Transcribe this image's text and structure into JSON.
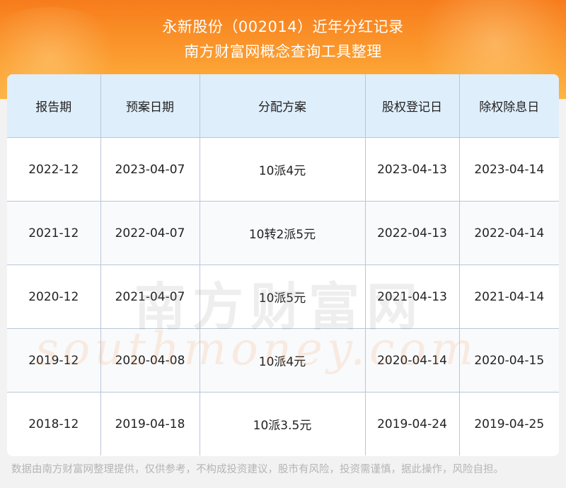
{
  "header": {
    "title": "永新股份（002014）近年分红记录",
    "subtitle": "南方财富网概念查询工具整理"
  },
  "table": {
    "columns": [
      "报告期",
      "预案日期",
      "分配方案",
      "股权登记日",
      "除权除息日"
    ],
    "rows": [
      [
        "2022-12",
        "2023-04-07",
        "10派4元",
        "2023-04-13",
        "2023-04-14"
      ],
      [
        "2021-12",
        "2022-04-07",
        "10转2派5元",
        "2022-04-13",
        "2022-04-14"
      ],
      [
        "2020-12",
        "2021-04-07",
        "10派5元",
        "2021-04-13",
        "2021-04-14"
      ],
      [
        "2019-12",
        "2020-04-08",
        "10派4元",
        "2020-04-14",
        "2020-04-15"
      ],
      [
        "2018-12",
        "2019-04-18",
        "10派3.5元",
        "2019-04-24",
        "2019-04-25"
      ]
    ]
  },
  "watermark": {
    "cn": "南方财富网",
    "en": "southmoney.com"
  },
  "footer": {
    "disclaimer": "数据由南方财富网整理提供，仅供参考，不构成投资建议，股市有风险，投资需谨慎，据此操作，风险自担。"
  },
  "colors": {
    "banner_top": "#f77c1b",
    "banner_bottom": "#fdb545",
    "header_row_bg": "#dfeefb",
    "grid_line": "#b9c7d6"
  }
}
